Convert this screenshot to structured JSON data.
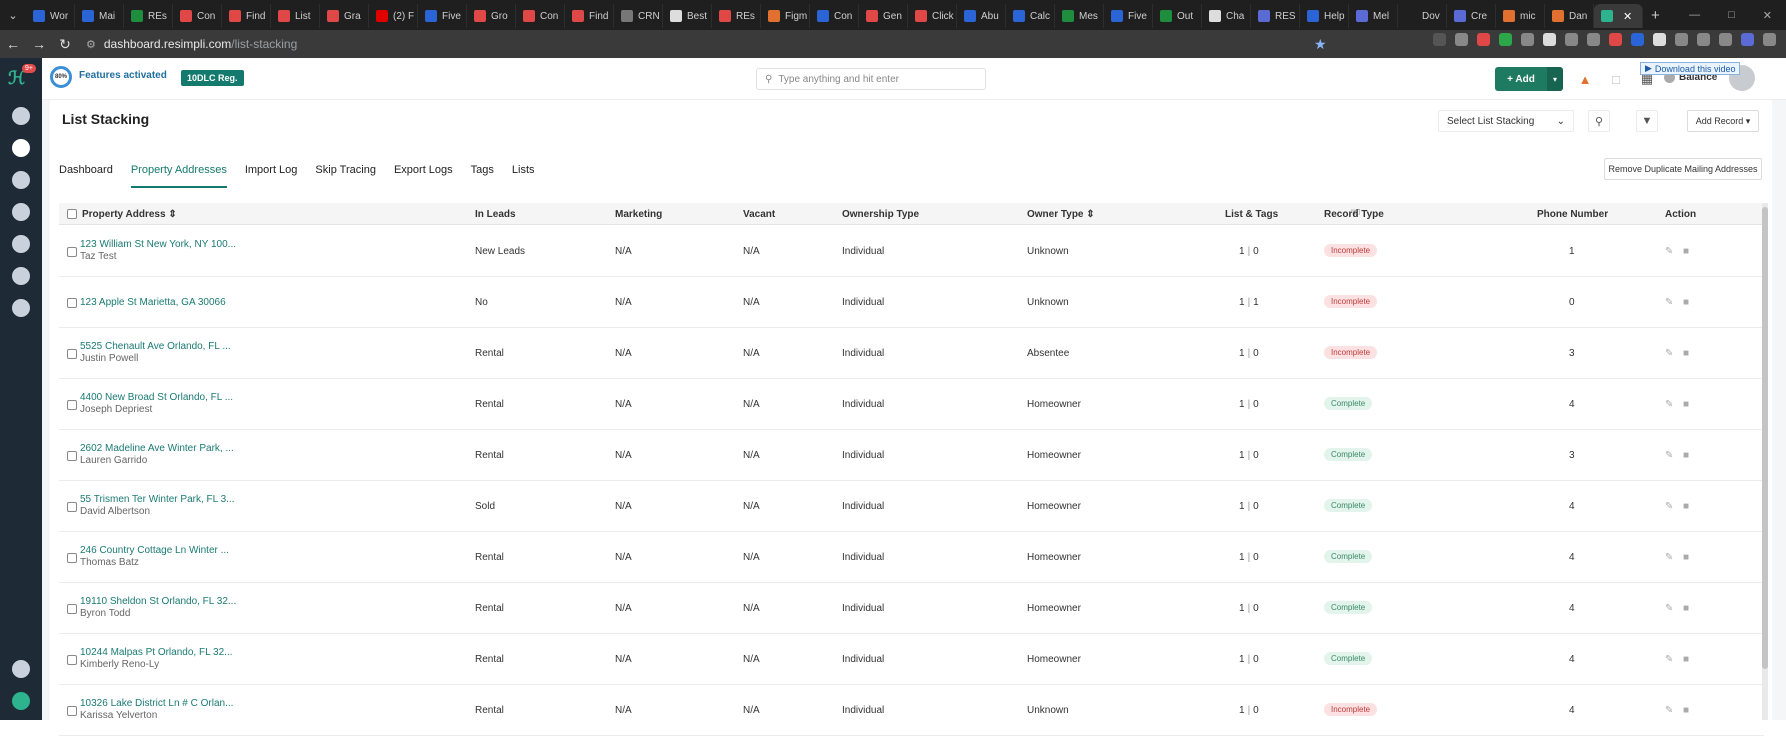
{
  "browser": {
    "tabs": [
      {
        "title": "Wor",
        "color": "#2b64d6"
      },
      {
        "title": "Mai",
        "color": "#2b64d6"
      },
      {
        "title": "REs",
        "color": "#1e8e3e"
      },
      {
        "title": "Con",
        "color": "#e04848"
      },
      {
        "title": "Find",
        "color": "#e04848"
      },
      {
        "title": "List",
        "color": "#e04848"
      },
      {
        "title": "Gra",
        "color": "#e04848"
      },
      {
        "title": "(2) F",
        "color": "#e00000"
      },
      {
        "title": "Five",
        "color": "#2b64d6"
      },
      {
        "title": "Gro",
        "color": "#e04848"
      },
      {
        "title": "Con",
        "color": "#e04848"
      },
      {
        "title": "Find",
        "color": "#e04848"
      },
      {
        "title": "CRN",
        "color": "#777777"
      },
      {
        "title": "Best",
        "color": "#dddddd"
      },
      {
        "title": "REs",
        "color": "#e04848"
      },
      {
        "title": "Figm",
        "color": "#e2702f"
      },
      {
        "title": "Con",
        "color": "#2b64d6"
      },
      {
        "title": "Gen",
        "color": "#e04848"
      },
      {
        "title": "Click",
        "color": "#e04848"
      },
      {
        "title": "Abu",
        "color": "#2b64d6"
      },
      {
        "title": "Calc",
        "color": "#2b64d6"
      },
      {
        "title": "Mes",
        "color": "#1e8e3e"
      },
      {
        "title": "Five",
        "color": "#2b64d6"
      },
      {
        "title": "Out",
        "color": "#1e8e3e"
      },
      {
        "title": "Cha",
        "color": "#dddddd"
      },
      {
        "title": "RES",
        "color": "#5a6bd6"
      },
      {
        "title": "Help",
        "color": "#2b64d6"
      },
      {
        "title": "Mel",
        "color": "#5a6bd6"
      },
      {
        "title": "Dov",
        "color": "#1f1f1f"
      },
      {
        "title": "Cre",
        "color": "#5a6bd6"
      },
      {
        "title": "mic",
        "color": "#e2702f"
      },
      {
        "title": "Dan",
        "color": "#e2702f"
      },
      {
        "title": "",
        "color": "#2eb38f"
      }
    ],
    "url_host": "dashboard.resimpli.com",
    "url_path": "/list-stacking",
    "extension_colors": [
      "#555555",
      "#888888",
      "#e04848",
      "#2ca74a",
      "#888888",
      "#dddddd",
      "#888888",
      "#888888",
      "#e04848",
      "#2b64d6",
      "#dddddd",
      "#888888",
      "#888888",
      "#888888",
      "#5a6bd6",
      "#888888"
    ]
  },
  "sidebar": {
    "notification_count": "9+",
    "items": [
      "dashboard-icon",
      "megaphone-icon",
      "hand-icon",
      "home-icon",
      "check-circle-icon",
      "user-icon",
      "dollar-icon",
      "settings-icon",
      "support-icon"
    ]
  },
  "header": {
    "features_percent": "80%",
    "features_label": "Features activated",
    "dlc_badge": "10DLC Reg.",
    "search_placeholder": "Type anything and hit enter",
    "add_label": "+ Add",
    "balance_label": "Balance",
    "download_video": "Download this video"
  },
  "page": {
    "title": "List Stacking",
    "select_list_label": "Select List Stacking",
    "add_record_label": "Add Record",
    "remove_duplicates_label": "Remove Duplicate Mailing Addresses",
    "tabs": [
      "Dashboard",
      "Property Addresses",
      "Import Log",
      "Skip Tracing",
      "Export Logs",
      "Tags",
      "Lists"
    ],
    "active_tab": "Property Addresses"
  },
  "table": {
    "columns": [
      "Property Address",
      "In Leads",
      "Marketing",
      "Vacant",
      "Ownership Type",
      "Owner Type",
      "List & Tags",
      "Record Type",
      "Phone Number",
      "Action"
    ],
    "rows": [
      {
        "address": "123 William St New York, NY 100...",
        "owner": "Taz Test",
        "in_leads": "New Leads",
        "marketing": "N/A",
        "vacant": "N/A",
        "ownership": "Individual",
        "owner_type": "Unknown",
        "lists": "1",
        "tags": "0",
        "record": "Incomplete",
        "phone": "1"
      },
      {
        "address": "123 Apple St Marietta, GA 30066",
        "owner": "",
        "in_leads": "No",
        "marketing": "N/A",
        "vacant": "N/A",
        "ownership": "Individual",
        "owner_type": "Unknown",
        "lists": "1",
        "tags": "1",
        "record": "Incomplete",
        "phone": "0"
      },
      {
        "address": "5525 Chenault Ave Orlando, FL ...",
        "owner": "Justin Powell",
        "in_leads": "Rental",
        "marketing": "N/A",
        "vacant": "N/A",
        "ownership": "Individual",
        "owner_type": "Absentee",
        "lists": "1",
        "tags": "0",
        "record": "Incomplete",
        "phone": "3"
      },
      {
        "address": "4400 New Broad St Orlando, FL ...",
        "owner": "Joseph Depriest",
        "in_leads": "Rental",
        "marketing": "N/A",
        "vacant": "N/A",
        "ownership": "Individual",
        "owner_type": "Homeowner",
        "lists": "1",
        "tags": "0",
        "record": "Complete",
        "phone": "4"
      },
      {
        "address": "2602 Madeline Ave Winter Park, ...",
        "owner": "Lauren Garrido",
        "in_leads": "Rental",
        "marketing": "N/A",
        "vacant": "N/A",
        "ownership": "Individual",
        "owner_type": "Homeowner",
        "lists": "1",
        "tags": "0",
        "record": "Complete",
        "phone": "3"
      },
      {
        "address": "55 Trismen Ter Winter Park, FL 3...",
        "owner": "David Albertson",
        "in_leads": "Sold",
        "marketing": "N/A",
        "vacant": "N/A",
        "ownership": "Individual",
        "owner_type": "Homeowner",
        "lists": "1",
        "tags": "0",
        "record": "Complete",
        "phone": "4"
      },
      {
        "address": "246 Country Cottage Ln Winter ...",
        "owner": "Thomas Batz",
        "in_leads": "Rental",
        "marketing": "N/A",
        "vacant": "N/A",
        "ownership": "Individual",
        "owner_type": "Homeowner",
        "lists": "1",
        "tags": "0",
        "record": "Complete",
        "phone": "4"
      },
      {
        "address": "19110 Sheldon St Orlando, FL 32...",
        "owner": "Byron Todd",
        "in_leads": "Rental",
        "marketing": "N/A",
        "vacant": "N/A",
        "ownership": "Individual",
        "owner_type": "Homeowner",
        "lists": "1",
        "tags": "0",
        "record": "Complete",
        "phone": "4"
      },
      {
        "address": "10244 Malpas Pt Orlando, FL 32...",
        "owner": "Kimberly Reno-Ly",
        "in_leads": "Rental",
        "marketing": "N/A",
        "vacant": "N/A",
        "ownership": "Individual",
        "owner_type": "Homeowner",
        "lists": "1",
        "tags": "0",
        "record": "Complete",
        "phone": "4"
      },
      {
        "address": "10326 Lake District Ln # C Orlan...",
        "owner": "Karissa Yelverton",
        "in_leads": "Rental",
        "marketing": "N/A",
        "vacant": "N/A",
        "ownership": "Individual",
        "owner_type": "Unknown",
        "lists": "1",
        "tags": "0",
        "record": "Incomplete",
        "phone": "4"
      }
    ]
  }
}
